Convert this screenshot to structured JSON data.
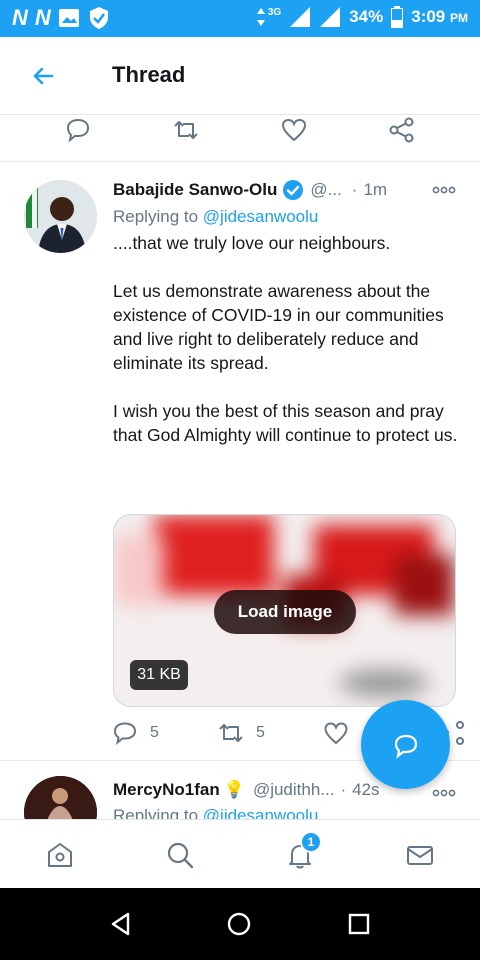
{
  "status_bar": {
    "left_icons": [
      "N",
      "N",
      "image-icon",
      "shield-icon"
    ],
    "network": "3G",
    "battery": "34%",
    "time": "3:09",
    "time_suffix": "PM"
  },
  "header": {
    "title": "Thread"
  },
  "tweet": {
    "author_name": "Babajide Sanwo-Olu",
    "handle": "@...",
    "separator": "·",
    "time": "1m",
    "replying_prefix": "Replying to ",
    "replying_to": "@jidesanwoolu",
    "paragraphs": [
      "....that we truly love our neighbours.",
      "Let us demonstrate awareness about the existence of COVID-19 in our communities and live right to deliberately reduce and eliminate its spread.",
      "I wish you the best of this season and pray that God Almighty will continue to protect us."
    ],
    "media": {
      "load_label": "Load image",
      "size_label": "31 KB"
    },
    "reply_count": "5",
    "retweet_count": "5"
  },
  "next_tweet": {
    "author_name": "MercyNo1fan",
    "emoji": "💡",
    "handle": "@judithh...",
    "separator": "·",
    "time": "42s",
    "replying_prefix": "Replying to ",
    "replying_to": "@jidesanwoolu"
  },
  "bottom_nav": {
    "notifications_badge": "1"
  },
  "colors": {
    "accent": "#1da1f2",
    "text": "#14171a",
    "muted": "#657786"
  }
}
